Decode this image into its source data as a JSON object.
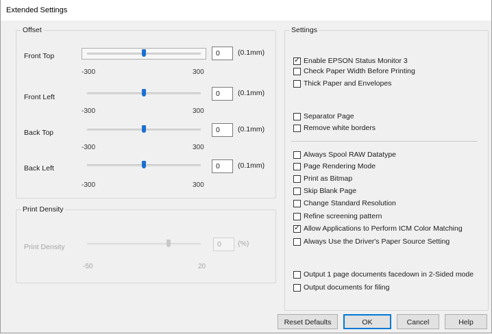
{
  "window": {
    "title": "Extended Settings"
  },
  "offset": {
    "group_label": "Offset",
    "rows": [
      {
        "label": "Front Top",
        "value": "0",
        "unit": "(0.1mm)",
        "min": "-300",
        "max": "300",
        "position": 0.5
      },
      {
        "label": "Front Left",
        "value": "0",
        "unit": "(0.1mm)",
        "min": "-300",
        "max": "300",
        "position": 0.5
      },
      {
        "label": "Back Top",
        "value": "0",
        "unit": "(0.1mm)",
        "min": "-300",
        "max": "300",
        "position": 0.5
      },
      {
        "label": "Back Left",
        "value": "0",
        "unit": "(0.1mm)",
        "min": "-300",
        "max": "300",
        "position": 0.5
      }
    ]
  },
  "print_density": {
    "group_label": "Print Density",
    "label": "Print Density",
    "value": "0",
    "unit": "(%)",
    "min": "-50",
    "max": "20",
    "position": 0.714
  },
  "settings": {
    "group_label": "Settings",
    "items": [
      {
        "label": "Enable EPSON Status Monitor 3",
        "checked": true
      },
      {
        "label": "Check Paper Width Before Printing",
        "checked": false
      },
      {
        "label": "Thick Paper and Envelopes",
        "checked": false
      },
      {
        "label": "Separator Page",
        "checked": false
      },
      {
        "label": "Remove white borders",
        "checked": false
      },
      {
        "label": "Always Spool RAW Datatype",
        "checked": false
      },
      {
        "label": "Page Rendering Mode",
        "checked": false
      },
      {
        "label": "Print as Bitmap",
        "checked": false
      },
      {
        "label": "Skip Blank Page",
        "checked": false
      },
      {
        "label": "Change Standard Resolution",
        "checked": false
      },
      {
        "label": "Refine screening pattern",
        "checked": false
      },
      {
        "label": "Allow Applications to Perform ICM Color Matching",
        "checked": true
      },
      {
        "label": "Always Use the Driver's Paper Source Setting",
        "checked": false
      },
      {
        "label": "Output 1 page documents facedown in 2-Sided mode",
        "checked": false
      },
      {
        "label": "Output documents for filing",
        "checked": false
      }
    ]
  },
  "buttons": {
    "reset": "Reset Defaults",
    "ok": "OK",
    "cancel": "Cancel",
    "help": "Help"
  }
}
